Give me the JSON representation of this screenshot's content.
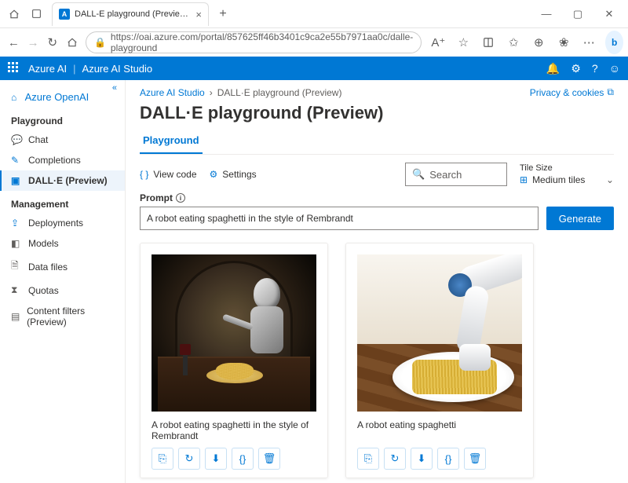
{
  "browser": {
    "tab_title": "DALL-E playground (Preview) | A...",
    "url": "https://oai.azure.com/portal/857625ff46b3401c9ca2e55b7971aa0c/dalle-playground"
  },
  "topbar": {
    "brand": "Azure AI",
    "studio": "Azure AI Studio"
  },
  "sidebar": {
    "brand": "Azure OpenAI",
    "sections": {
      "playground": "Playground",
      "management": "Management"
    },
    "items": {
      "chat": "Chat",
      "completions": "Completions",
      "dalle": "DALL·E (Preview)",
      "deployments": "Deployments",
      "models": "Models",
      "datafiles": "Data files",
      "quotas": "Quotas",
      "contentfilters": "Content filters (Preview)"
    }
  },
  "breadcrumbs": {
    "root": "Azure AI Studio",
    "current": "DALL·E playground (Preview)",
    "privacy": "Privacy & cookies"
  },
  "page": {
    "title": "DALL·E playground (Preview)",
    "tab": "Playground"
  },
  "toolbar": {
    "view_code": "View code",
    "settings": "Settings",
    "search_placeholder": "Search",
    "tile_size_label": "Tile Size",
    "tile_size_value": "Medium tiles"
  },
  "prompt": {
    "label": "Prompt",
    "value": "A robot eating spaghetti in the style of Rembrandt",
    "button": "Generate"
  },
  "results": [
    {
      "caption": "A robot eating spaghetti in the style of Rembrandt"
    },
    {
      "caption": "A robot eating spaghetti"
    }
  ],
  "card_actions": {
    "copy": "copy",
    "regen": "regen",
    "download": "download",
    "code": "code",
    "delete": "delete"
  }
}
